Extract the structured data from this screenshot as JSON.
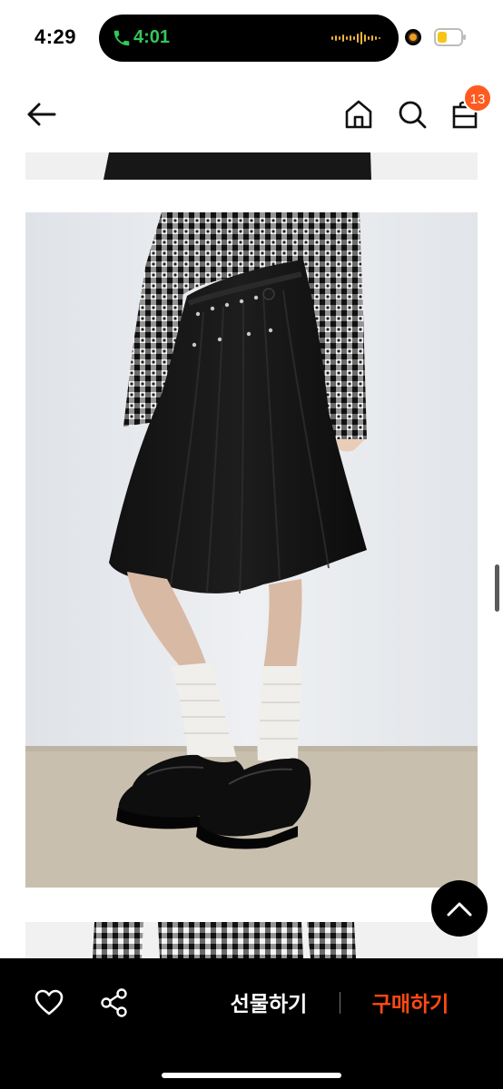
{
  "status_bar": {
    "time": "4:29",
    "call_duration": "4:01"
  },
  "nav": {
    "cart_count": "13"
  },
  "bottom_bar": {
    "gift_label": "선물하기",
    "buy_label": "구매하기"
  },
  "icons": [
    "back-arrow-icon",
    "home-icon",
    "search-icon",
    "shopping-bag-icon",
    "heart-icon",
    "share-icon",
    "chevron-up-icon",
    "phone-icon",
    "waveform-icon",
    "battery-icon"
  ],
  "colors": {
    "accent": "#ff4a14",
    "badge": "#ff5a1f",
    "call_green": "#34c759",
    "bottom_bar_bg": "#000000"
  }
}
